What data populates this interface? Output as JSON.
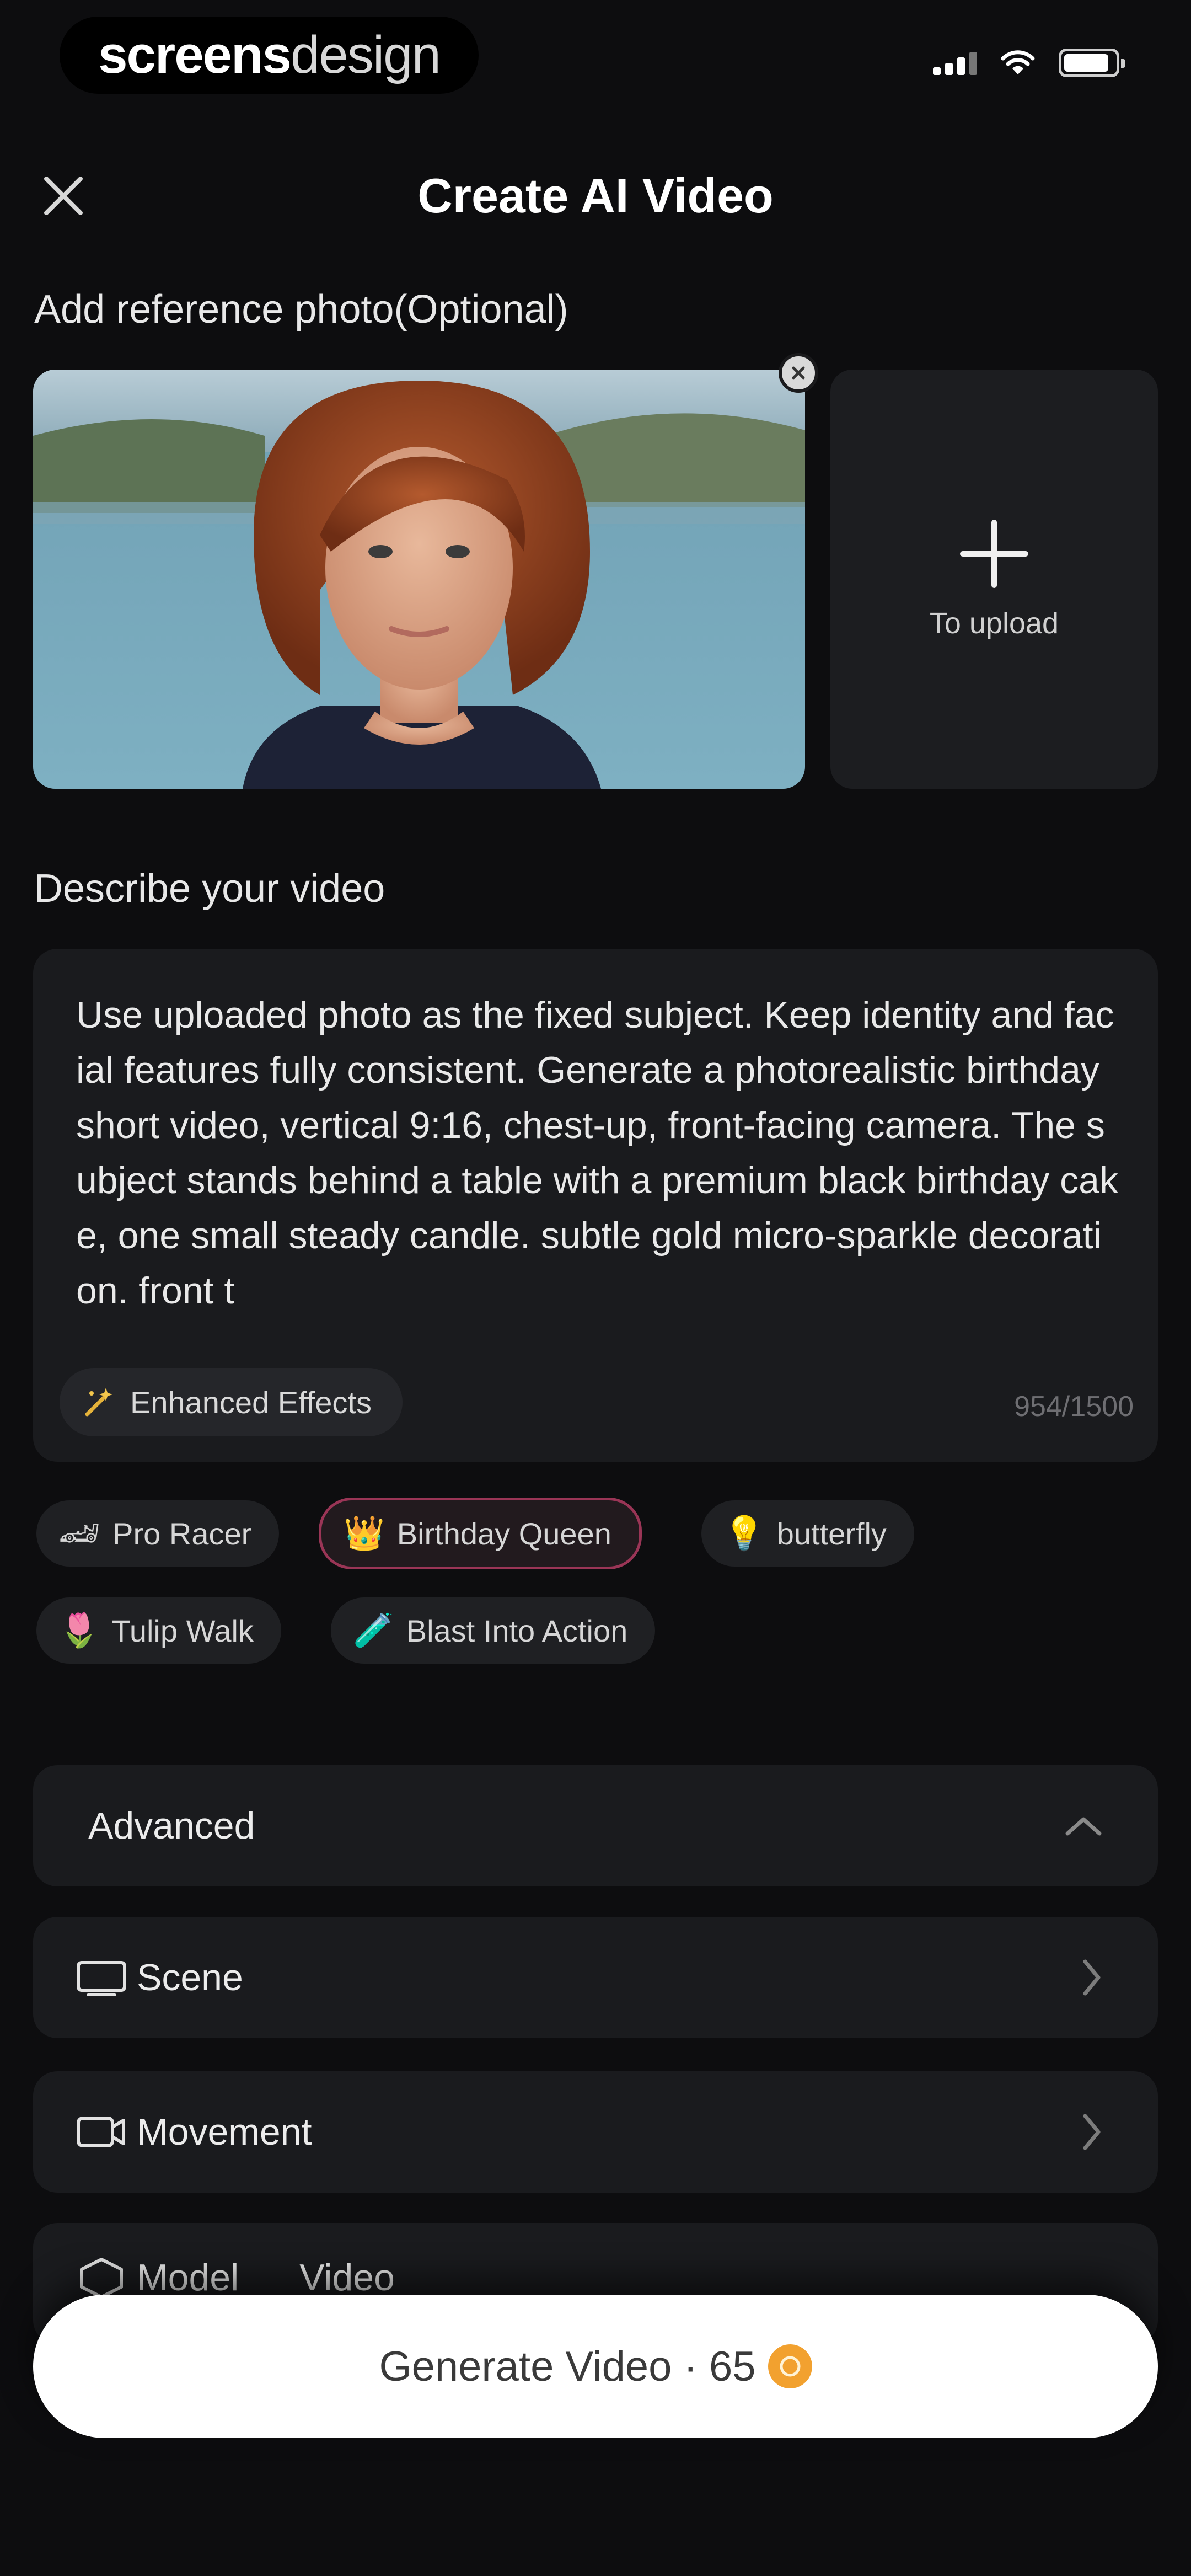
{
  "status_bar": {
    "brand_bold": "screens",
    "brand_light": "design"
  },
  "header": {
    "title": "Create AI Video",
    "close_icon": "close-icon"
  },
  "reference": {
    "label": "Add reference photo(Optional)",
    "upload_label": "To upload"
  },
  "prompt": {
    "label": "Describe your video",
    "text": "Use uploaded photo as the fixed subject. Keep identity and facial features fully consistent. Generate a photorealistic birthday short video, vertical 9:16, chest-up, front-facing camera.  The subject stands behind a table with a premium black birthday cake, one small steady candle. subtle gold micro-sparkle decoration. front t",
    "enhance_label": "Enhanced Effects",
    "char_count": "954/1500"
  },
  "templates": [
    {
      "emoji": "🏎",
      "label": "Pro Racer"
    },
    {
      "emoji": "👑",
      "label": "Birthday Queen",
      "selected": true
    },
    {
      "emoji": "💡",
      "label": "butterfly"
    },
    {
      "emoji": "🌷",
      "label": "Tulip Walk"
    },
    {
      "emoji": "🧪",
      "label": "Blast Into Action"
    }
  ],
  "advanced": {
    "label": "Advanced",
    "rows": {
      "scene": "Scene",
      "movement": "Movement",
      "model": "Model",
      "model_value": "Video"
    }
  },
  "generate": {
    "label": "Generate Video · 65",
    "accent": "#f2a12f"
  },
  "colors": {
    "background": "#0d0d0f",
    "card": "#1a1b1e",
    "selected_border": "#9a3556"
  }
}
